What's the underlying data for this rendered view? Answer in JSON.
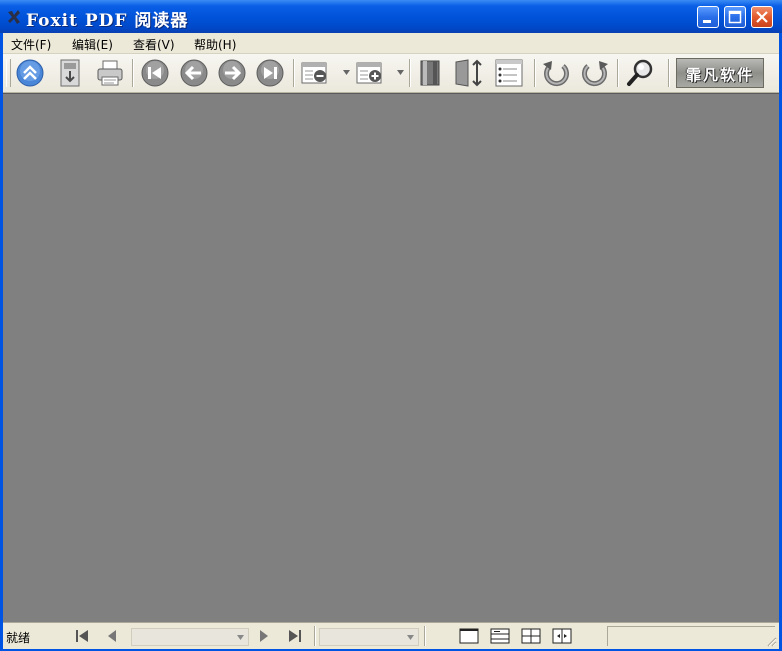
{
  "window": {
    "title": "Foxit PDF 阅读器",
    "icon": "foxit-app-icon"
  },
  "menu": {
    "items": [
      {
        "label": "文件(F)"
      },
      {
        "label": "编辑(E)"
      },
      {
        "label": "查看(V)"
      },
      {
        "label": "帮助(H)"
      }
    ]
  },
  "toolbar": {
    "logo_text": "霏凡软件",
    "tools": [
      {
        "icon": "scroll-up-icon"
      },
      {
        "icon": "save-download-icon"
      },
      {
        "icon": "print-icon"
      },
      {
        "icon": "first-page-icon"
      },
      {
        "icon": "previous-page-icon"
      },
      {
        "icon": "next-page-icon"
      },
      {
        "icon": "last-page-icon"
      },
      {
        "icon": "zoom-out-icon"
      },
      {
        "icon": "zoom-in-icon"
      },
      {
        "icon": "bookmark-icon"
      },
      {
        "icon": "fit-height-icon"
      },
      {
        "icon": "page-thumbnails-icon"
      },
      {
        "icon": "rotate-left-icon"
      },
      {
        "icon": "rotate-right-icon"
      },
      {
        "icon": "search-magnifier-icon"
      }
    ]
  },
  "statusbar": {
    "status": "就绪",
    "page_value": "",
    "zoom_value": ""
  },
  "colors": {
    "title_bar": "#0a5fe6",
    "document_background": "#808080",
    "chrome": "#ece9d8"
  }
}
